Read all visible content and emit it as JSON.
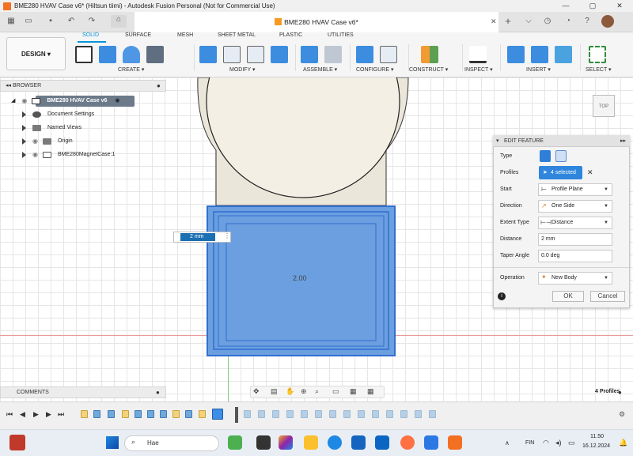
{
  "window": {
    "title": "BME280 HVAV Case v6* (Hiltsun tiimi) - Autodesk Fusion Personal (Not for Commercial Use)",
    "min": "—",
    "max": "▢",
    "close": "✕"
  },
  "doc_tab": {
    "label": "BME280 HVAV Case v6*",
    "close": "✕"
  },
  "toolbar": {
    "design_label": "DESIGN ▾",
    "tabs": [
      "SOLID",
      "SURFACE",
      "MESH",
      "SHEET METAL",
      "PLASTIC",
      "UTILITIES"
    ],
    "groups": [
      "CREATE ▾",
      "MODIFY ▾",
      "ASSEMBLE ▾",
      "CONFIGURE ▾",
      "CONSTRUCT ▾",
      "INSPECT ▾",
      "INSERT ▾",
      "SELECT ▾"
    ]
  },
  "browser": {
    "header": "BROWSER",
    "root": "BME280 HVAV Case v6",
    "items": [
      "Document Settings",
      "Named Views",
      "Origin",
      "BME280MagnetCase:1"
    ]
  },
  "canvas": {
    "dimension_value": "2.00",
    "input_value": "2 mm",
    "viewcube": "TOP"
  },
  "edit_feature": {
    "title": "EDIT FEATURE",
    "labels": {
      "type": "Type",
      "profiles": "Profiles",
      "start": "Start",
      "direction": "Direction",
      "extent_type": "Extent Type",
      "distance": "Distance",
      "taper": "Taper Angle",
      "operation": "Operation"
    },
    "profiles_value": "4 selected",
    "start_value": "Profile Plane",
    "direction_value": "One Side",
    "extent_value": "Distance",
    "distance_value": "2 mm",
    "taper_value": "0.0 deg",
    "operation_value": "New Body",
    "ok": "OK",
    "cancel": "Cancel"
  },
  "comments": {
    "label": "COMMENTS"
  },
  "status": {
    "profiles_count": "4 Profiles"
  },
  "taskbar": {
    "search_placeholder": "Hae",
    "language": "FIN",
    "time": "11.50",
    "date": "16.12.2024"
  },
  "colors": {
    "accent": "#0696d7",
    "body_fill": "#6c9fe0",
    "body_edge": "#2f6fcf",
    "case_fill": "#ebe6da"
  }
}
